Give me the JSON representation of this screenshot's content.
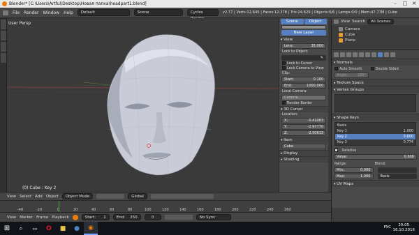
{
  "window": {
    "title": "Blender* [C:\\Users\\Artful\\Desktop\\Новая папка\\headpart1.blend]"
  },
  "info": {
    "menus": [
      "File",
      "Render",
      "Window",
      "Help"
    ],
    "layout": "Default",
    "scene": "Scene",
    "engine": "Cycles Render",
    "stats": "v2.77 | Verts:12,645 | Faces:12,378 | Tris:24,629 | Objects:0/6 | Lamps:0/0 | Mem:47.77M | Cube"
  },
  "viewport": {
    "label": "User Persp",
    "object_label": "(0) Cube : Key 2"
  },
  "npanel": {
    "tab_scene": "Scene",
    "tab_object": "Object",
    "new_layer": "New Layer",
    "view_header": "View",
    "lens_label": "Lens:",
    "lens_value": "35.000",
    "lock_object_label": "Lock to Object:",
    "lock_cursor": "Lock to Cursor",
    "lock_camera": "Lock Camera to View",
    "clip_label": "Clip:",
    "clip_start_label": "Start:",
    "clip_start": "0.100",
    "clip_end_label": "End:",
    "clip_end": "1000.000",
    "local_camera_label": "Local Camera:",
    "local_camera": "Camera",
    "render_border": "Render Border",
    "cursor_header": "3D Cursor",
    "location_label": "Location:",
    "x_label": "X:",
    "x": "-0.41083",
    "y_label": "Y:",
    "y": "-2.97770",
    "z_label": "Z:",
    "z": "-2.50613",
    "item_header": "Item",
    "item_name": "Cube",
    "display_header": "Display",
    "shading_header": "Shading"
  },
  "outliner": {
    "view": "View",
    "search": "Search",
    "filter": "All Scenes",
    "items": [
      "Camera",
      "Cube",
      "Plane"
    ]
  },
  "properties": {
    "normals_header": "Normals",
    "auto_smooth": "Auto Smooth",
    "double_sided": "Double Sided",
    "angle_label": "Angle:",
    "angle": "180°",
    "texture_space": "Texture Space",
    "vertex_groups": "Vertex Groups",
    "shape_keys": "Shape Keys",
    "keys": [
      {
        "name": "Basis",
        "value": ""
      },
      {
        "name": "Key 1",
        "value": "1.000"
      },
      {
        "name": "Key 2",
        "value": "0.600"
      },
      {
        "name": "Key 3",
        "value": "0.774"
      }
    ],
    "relative": "Relative",
    "value_label": "Value:",
    "value": "0.600",
    "range_label": "Range:",
    "min_label": "Min:",
    "min": "0.000",
    "max_label": "Max:",
    "max": "1.000",
    "blend_label": "Blend:",
    "blend": "Basis",
    "uv_maps": "UV Maps"
  },
  "viewport_header": {
    "menus": [
      "View",
      "Select",
      "Add",
      "Object"
    ],
    "mode": "Object Mode",
    "orientation": "Global"
  },
  "timeline": {
    "ticks": [
      "-40",
      "-20",
      "0",
      "20",
      "40",
      "60",
      "80",
      "100",
      "120",
      "140",
      "160",
      "180",
      "200",
      "220",
      "240",
      "260"
    ],
    "menus": [
      "View",
      "Marker",
      "Frame",
      "Playback"
    ],
    "start_label": "Start:",
    "start": "1",
    "end_label": "End:",
    "end": "250",
    "current": "0",
    "sync": "No Sync"
  },
  "taskbar": {
    "lang": "РУС",
    "time": "20:05",
    "date": "16.10.2016"
  }
}
